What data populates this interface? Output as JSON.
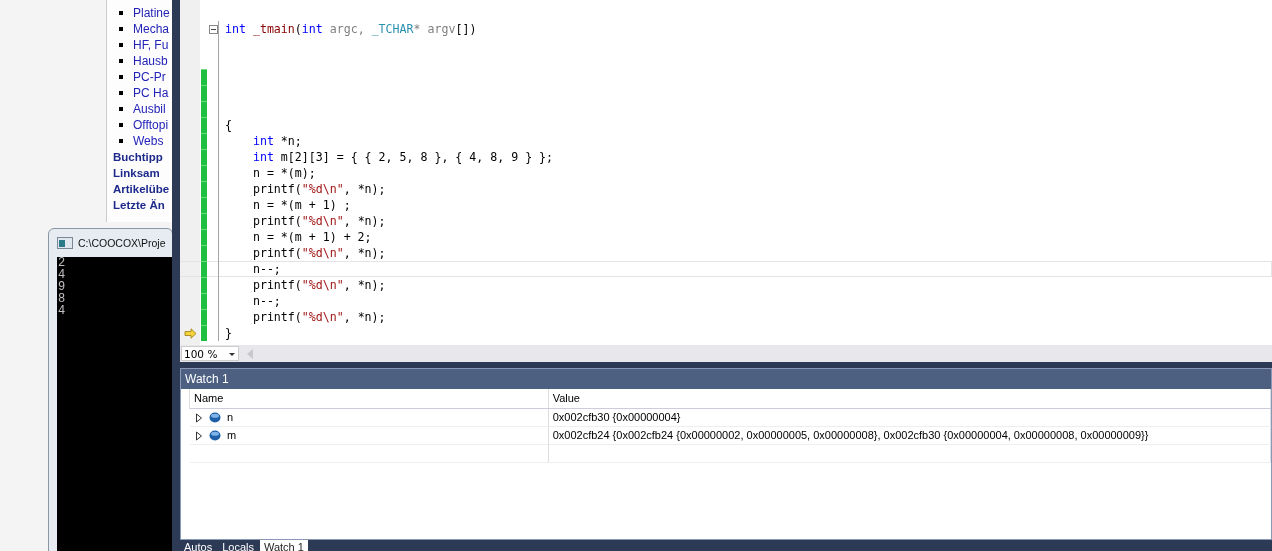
{
  "browser_page": {
    "nav_items": [
      "Platine",
      "Mecha",
      "HF, Fu",
      "Hausb",
      "PC-Pr",
      "PC Ha",
      "Ausbil",
      "Offtopi",
      "Webs"
    ],
    "sections": [
      "Buchtipp",
      "Linksam",
      "Artikelübe",
      "Letzte Än"
    ]
  },
  "console": {
    "title": "C:\\COOCOX\\Proje",
    "output": [
      "2",
      "4",
      "9",
      "8",
      "4"
    ]
  },
  "editor": {
    "lines": [
      {
        "tokens": [
          {
            "text": "int",
            "kind": "keyword"
          },
          {
            "text": " _tmain",
            "kind": "function"
          },
          {
            "text": "(",
            "kind": "plain"
          },
          {
            "text": "int",
            "kind": "keyword"
          },
          {
            "text": " argc, ",
            "kind": "param"
          },
          {
            "text": "_TCHAR",
            "kind": "type"
          },
          {
            "text": "* argv",
            "kind": "param"
          },
          {
            "text": "[])",
            "kind": "plain"
          }
        ],
        "fold": true,
        "changed": false,
        "current": false,
        "next_statement": false
      },
      {
        "fold": false,
        "changed": false,
        "current": false,
        "next_statement": false
      },
      {
        "fold": false,
        "changed": false,
        "current": false,
        "next_statement": false
      },
      {
        "fold": false,
        "changed": true,
        "current": false,
        "next_statement": false
      },
      {
        "fold": false,
        "changed": true,
        "current": false,
        "next_statement": false
      },
      {
        "fold": false,
        "changed": true,
        "current": false,
        "next_statement": false
      },
      {
        "tokens": [
          {
            "text": "{",
            "kind": "plain"
          }
        ],
        "fold": false,
        "changed": true,
        "current": false,
        "next_statement": false
      },
      {
        "tokens": [
          {
            "text": "    int",
            "kind": "keyword"
          },
          {
            "text": " *n;",
            "kind": "plain"
          }
        ],
        "fold": false,
        "changed": true,
        "current": false,
        "next_statement": false
      },
      {
        "tokens": [
          {
            "text": "    int",
            "kind": "keyword"
          },
          {
            "text": " m[2][3] = { { 2, 5, 8 }, { 4, 8, 9 } };",
            "kind": "plain"
          }
        ],
        "fold": false,
        "changed": true,
        "current": false,
        "next_statement": false
      },
      {
        "tokens": [
          {
            "text": "    n = *(m);",
            "kind": "plain"
          }
        ],
        "fold": false,
        "changed": true,
        "current": false,
        "next_statement": false
      },
      {
        "tokens": [
          {
            "text": "    printf(",
            "kind": "plain"
          },
          {
            "text": "\"%d\\n\"",
            "kind": "string"
          },
          {
            "text": ", *n);",
            "kind": "plain"
          }
        ],
        "fold": false,
        "changed": true,
        "current": false,
        "next_statement": false
      },
      {
        "tokens": [
          {
            "text": "    n = *(m + 1) ;",
            "kind": "plain"
          }
        ],
        "fold": false,
        "changed": true,
        "current": false,
        "next_statement": false
      },
      {
        "tokens": [
          {
            "text": "    printf(",
            "kind": "plain"
          },
          {
            "text": "\"%d\\n\"",
            "kind": "string"
          },
          {
            "text": ", *n);",
            "kind": "plain"
          }
        ],
        "fold": false,
        "changed": true,
        "current": false,
        "next_statement": false
      },
      {
        "tokens": [
          {
            "text": "    n = *(m + 1) + 2;",
            "kind": "plain"
          }
        ],
        "fold": false,
        "changed": true,
        "current": false,
        "next_statement": false
      },
      {
        "tokens": [
          {
            "text": "    printf(",
            "kind": "plain"
          },
          {
            "text": "\"%d\\n\"",
            "kind": "string"
          },
          {
            "text": ", *n);",
            "kind": "plain"
          }
        ],
        "fold": false,
        "changed": true,
        "current": false,
        "next_statement": false
      },
      {
        "tokens": [
          {
            "text": "    n--;",
            "kind": "plain"
          }
        ],
        "fold": false,
        "changed": true,
        "current": true,
        "next_statement": false
      },
      {
        "tokens": [
          {
            "text": "    printf(",
            "kind": "plain"
          },
          {
            "text": "\"%d\\n\"",
            "kind": "string"
          },
          {
            "text": ", *n);",
            "kind": "plain"
          }
        ],
        "fold": false,
        "changed": true,
        "current": false,
        "next_statement": false
      },
      {
        "tokens": [
          {
            "text": "    n--;",
            "kind": "plain"
          }
        ],
        "fold": false,
        "changed": true,
        "current": false,
        "next_statement": false
      },
      {
        "tokens": [
          {
            "text": "    printf(",
            "kind": "plain"
          },
          {
            "text": "\"%d\\n\"",
            "kind": "string"
          },
          {
            "text": ", *n);",
            "kind": "plain"
          }
        ],
        "fold": false,
        "changed": true,
        "current": false,
        "next_statement": false
      },
      {
        "tokens": [
          {
            "text": "}",
            "kind": "plain"
          }
        ],
        "fold": false,
        "changed": true,
        "current": false,
        "next_statement": true
      }
    ],
    "zoom": "100 %"
  },
  "watch": {
    "title": "Watch 1",
    "columns": [
      "Name",
      "Value"
    ],
    "rows": [
      {
        "name": "n",
        "value": "0x002cfb30 {0x00000004}",
        "expanded": false
      },
      {
        "name": "m",
        "value": "0x002cfb24 {0x002cfb24 {0x00000002, 0x00000005, 0x00000008}, 0x002cfb30 {0x00000004, 0x00000008, 0x00000009}}",
        "expanded": false
      }
    ]
  },
  "tabs": [
    {
      "label": "Autos",
      "selected": false
    },
    {
      "label": "Locals",
      "selected": false
    },
    {
      "label": "Watch 1",
      "selected": true
    }
  ]
}
